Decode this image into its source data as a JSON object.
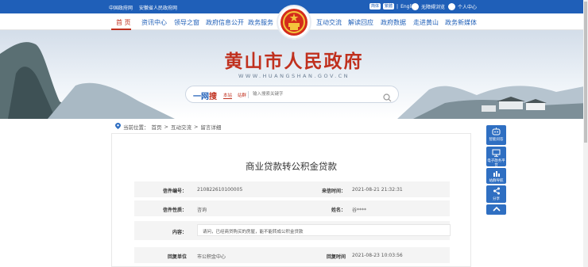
{
  "topbar": {
    "link1": "中国政府网",
    "link2": "安徽省人民政府网",
    "lang_cn": "简体",
    "lang_tw": "繁體",
    "lang_sep": "|",
    "lang_en": "English",
    "accessibility": "无障碍浏览",
    "personal": "个人中心"
  },
  "nav": {
    "items": [
      "首 页",
      "资讯中心",
      "领导之窗",
      "政府信息公开",
      "政务服务",
      "互动交流",
      "解读回应",
      "政府数据",
      "走进黄山",
      "政务新媒体"
    ],
    "active_index": 0
  },
  "banner": {
    "title": "黄山市人民政府",
    "url": "WWW.HUANGSHAN.GOV.CN"
  },
  "search": {
    "brand_prefix": "一网",
    "brand_suffix": "搜",
    "scope_local": "本站",
    "scope_all": "站群",
    "placeholder": "输入搜索关键字"
  },
  "breadcrumb": {
    "prefix": "当前位置：",
    "items": [
      "首页",
      "互动交流",
      "留言详细"
    ],
    "separator": ">"
  },
  "message": {
    "title": "商业贷款转公积金贷款",
    "letter_id_label": "信件编号：",
    "letter_id": "210822610100005",
    "date_label": "来信时间：",
    "date": "2021-08-21 21:32:31",
    "type_label": "信件性质：",
    "type": "咨询",
    "name_label": "姓名：",
    "name": "谷****",
    "content_label": "内容：",
    "content": "请问，已经商贷购买的房屋，能不能转成公积金贷款",
    "reply_unit_label": "回复单位",
    "reply_unit": "市公积金中心",
    "reply_time_label": "回复时间",
    "reply_time": "2021-08-23 10:03:56"
  },
  "sidebar": {
    "items": [
      {
        "label": "智能问答",
        "icon": "robot-icon"
      },
      {
        "label": "电子政务平台",
        "icon": "monitor-icon"
      },
      {
        "label": "站群导航",
        "icon": "chart-icon"
      },
      {
        "label": "分享",
        "icon": "share-icon"
      }
    ],
    "top_icon": "chevron-up-icon"
  },
  "colors": {
    "brand_blue": "#1f5fb8",
    "brand_red": "#c0301e",
    "sidebar_blue": "#2f6fc2"
  }
}
